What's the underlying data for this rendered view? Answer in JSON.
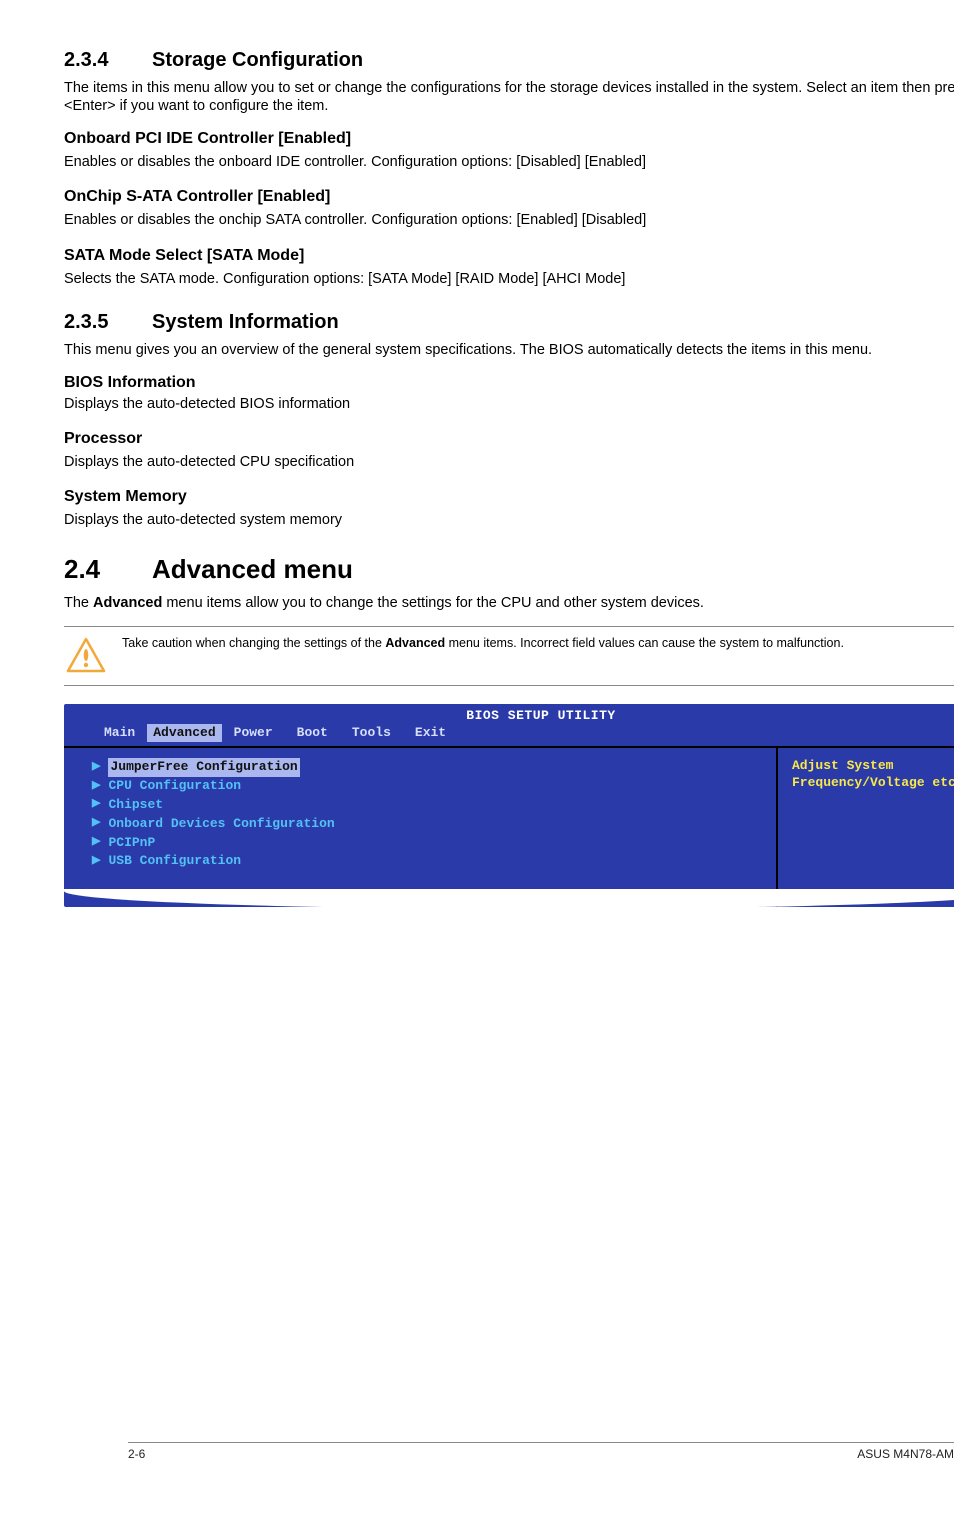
{
  "s234": {
    "heading_num": "2.3.4",
    "heading_title": "Storage Configuration",
    "intro": "The items in this menu allow you to set or change the configurations for the storage devices installed in the system. Select an item then press <Enter> if you want to configure the item.",
    "sub1_title": "Onboard PCI IDE Controller [Enabled]",
    "sub1_body": "Enables or disables the onboard IDE controller. Configuration options: [Disabled] [Enabled]",
    "sub2_title": "OnChip S-ATA Controller [Enabled]",
    "sub2_body": "Enables or disables the onchip SATA controller. Configuration options: [Enabled] [Disabled]",
    "sub3_title": "SATA Mode Select [SATA Mode]",
    "sub3_body": "Selects the SATA mode. Configuration options: [SATA Mode] [RAID Mode] [AHCI Mode]"
  },
  "s235": {
    "heading_num": "2.3.5",
    "heading_title": "System Information",
    "intro": "This menu gives you an overview of the general system specifications. The BIOS automatically detects the items in this menu.",
    "sub1_title": "BIOS Information",
    "sub1_body": "Displays the auto-detected BIOS information",
    "sub2_title": "Processor",
    "sub2_body": "Displays the auto-detected CPU specification",
    "sub3_title": "System Memory",
    "sub3_body": "Displays the auto-detected system memory"
  },
  "s24": {
    "heading_num": "2.4",
    "heading_title": "Advanced menu",
    "intro_pre": "The ",
    "intro_bold": "Advanced",
    "intro_post": " menu items allow you to change the settings for the CPU and other system devices.",
    "callout_pre": "Take caution when changing the settings of the ",
    "callout_bold": "Advanced",
    "callout_post": " menu items. Incorrect field values can cause the system to malfunction."
  },
  "bios": {
    "title": "BIOS SETUP UTILITY",
    "menu": {
      "main": "Main",
      "advanced": "Advanced",
      "power": "Power",
      "boot": "Boot",
      "tools": "Tools",
      "exit": "Exit"
    },
    "items": [
      "JumperFree Configuration",
      "CPU Configuration",
      "Chipset",
      "Onboard Devices Configuration",
      "PCIPnP",
      "USB Configuration"
    ],
    "help_line1": "Adjust System",
    "help_line2": "Frequency/Voltage etc."
  },
  "footer": {
    "left": "2-6",
    "right": "ASUS M4N78-AM"
  }
}
